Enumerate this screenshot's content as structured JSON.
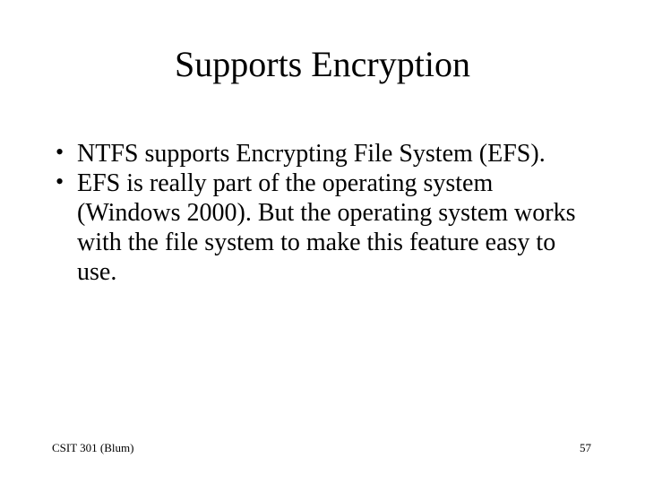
{
  "title": "Supports Encryption",
  "bullets": [
    "NTFS supports Encrypting File System (EFS).",
    "EFS is really part of the operating system (Windows 2000).  But the operating system works with the file system to make this feature easy to use."
  ],
  "footer": {
    "left": "CSIT 301 (Blum)",
    "right": "57"
  }
}
